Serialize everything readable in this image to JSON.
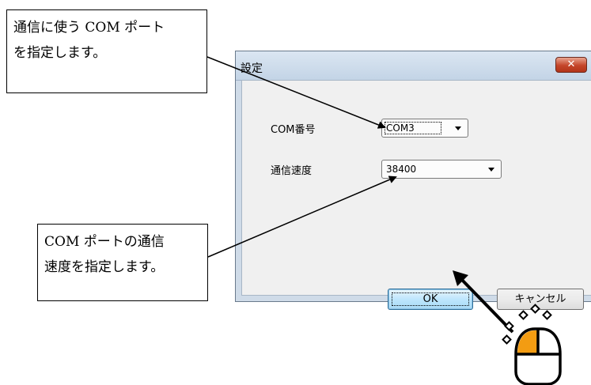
{
  "callouts": {
    "top": [
      "通信に使う COM ポート",
      "を指定します。"
    ],
    "bottom": [
      "COM ポートの通信",
      "速度を指定します。"
    ]
  },
  "dialog": {
    "title": "設定",
    "close_symbol": "✕",
    "com_label": "COM番号",
    "com_value": "COM3",
    "speed_label": "通信速度",
    "speed_value": "38400",
    "ok_label": "OK",
    "cancel_label": "キャンセル"
  },
  "colors": {
    "mouse_left_button": "#f39c12",
    "close_button": "#c4452a",
    "ok_button": "#bee6fd"
  },
  "icons": {
    "mouse": "mouse-icon",
    "dropdown": "chevron-down-icon",
    "close": "close-icon"
  }
}
